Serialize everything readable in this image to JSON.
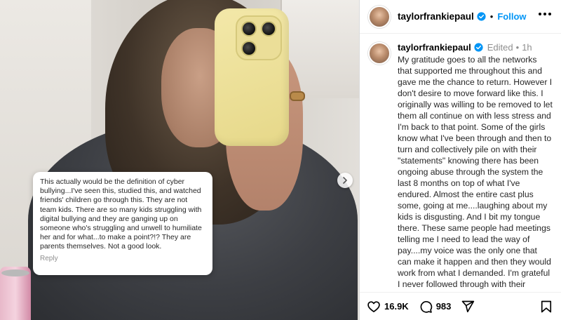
{
  "post": {
    "comment_overlay": {
      "text": "This actually would be the definition of cyber bullying...I've seen this, studied this, and watched friends' children go through this. They are not team kids. There are so many kids struggling with digital bullying and they are ganging up on someone who's struggling and unwell to humiliate her and for what...to make a point?!? They are parents themselves. Not a good look.",
      "reply_label": "Reply"
    }
  },
  "header": {
    "username": "taylorfrankiepaul",
    "separator": "•",
    "follow_label": "Follow"
  },
  "caption": {
    "username": "taylorfrankiepaul",
    "edited": "Edited",
    "separator": "•",
    "time": "1h",
    "text": "My gratitude goes to all the networks that supported me throughout this and gave me the chance to return. However I don't desire to move forward like this. I originally was willing to be removed to let them all continue on with less stress and I'm back to that point. Some of the girls know what I've been through and then to turn and collectively pile on with their \"statements\" knowing there has been ongoing abuse through the system the last 8 months on top of what I've endured. Almost the entire cast plus some, going at me....laughing about my kids is disgusting. And I bit my tongue there. These same people had meetings telling me I need to lead the way of pay....my voice was the only one that can make it happen and then they would work from what I demanded. I'm grateful I never followed through with their requests of demands and I'm grateful I"
  },
  "actions": {
    "likes": "16.9K",
    "comments": "983"
  },
  "icons": [
    "verified-badge-icon",
    "more-options-icon",
    "next-arrow-icon",
    "heart-icon",
    "comment-icon",
    "share-icon",
    "bookmark-icon"
  ],
  "colors": {
    "accent": "#0095f6",
    "text": "#262626",
    "muted": "#8e8e8e"
  }
}
